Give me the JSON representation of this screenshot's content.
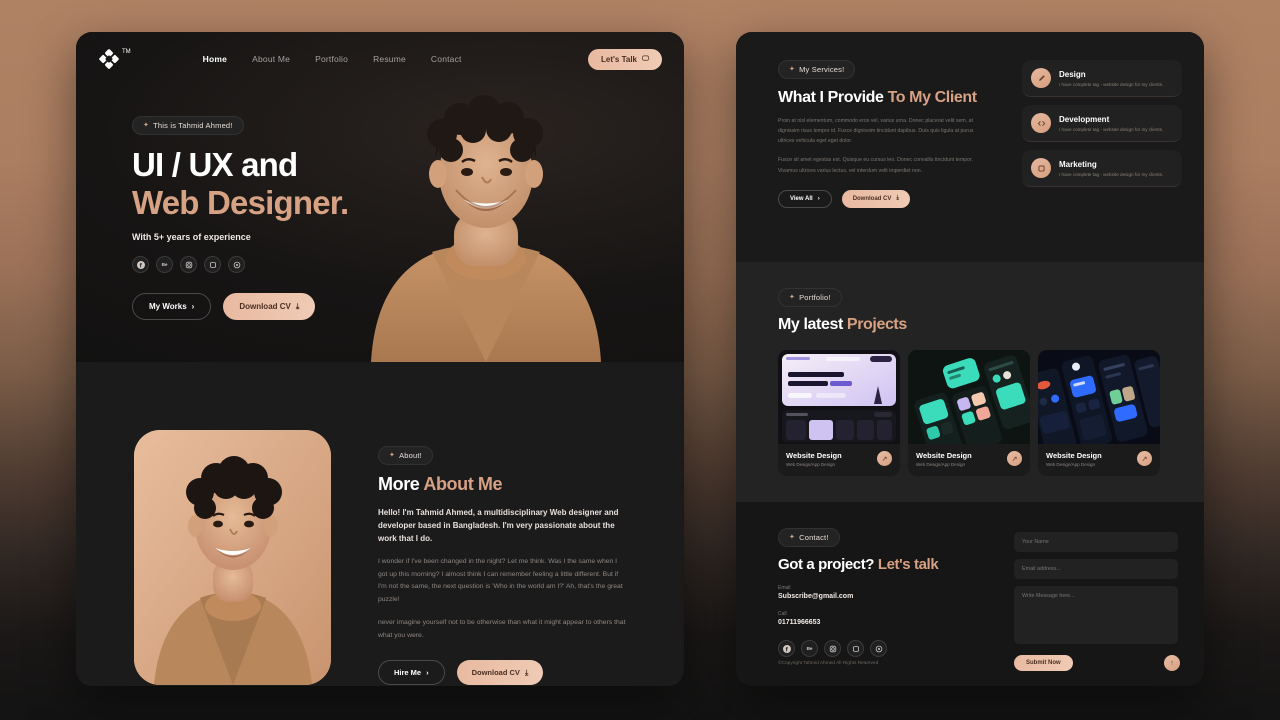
{
  "colors": {
    "accent": "#d7a183",
    "peach_button": "#e8b9a0",
    "panel_bg": "#1a1a1a",
    "page_gradient_top": "#b08264",
    "page_gradient_bottom": "#131313"
  },
  "left_panel": {
    "nav": {
      "logo_tm": "TM",
      "links": [
        {
          "label": "Home",
          "active": true
        },
        {
          "label": "About Me",
          "active": false
        },
        {
          "label": "Portfolio",
          "active": false
        },
        {
          "label": "Resume",
          "active": false
        },
        {
          "label": "Contact",
          "active": false
        }
      ],
      "cta_label": "Let's Talk"
    },
    "hero": {
      "tag": "This is Tahmid Ahmed!",
      "title_line1": "UI / UX and",
      "title_line2": "Web Designer.",
      "subtitle": "With 5+ years of experience",
      "socials": [
        "facebook-icon",
        "behance-icon",
        "instagram-icon",
        "twitter-icon",
        "dribbble-icon"
      ],
      "button_primary": "My Works",
      "button_secondary": "Download CV"
    },
    "about": {
      "tag": "About!",
      "title_plain": "More ",
      "title_accent": "About Me",
      "lead": "Hello! I'm Tahmid Ahmed, a multidisciplinary Web designer and developer based in Bangladesh. I'm very passionate about the work that I do.",
      "paragraph1": "I wonder if I've been changed in the night? Let me think. Was I the same when I got up this morning? I almost think I can remember feeling a little different. But if I'm not the same, the next question is 'Who in the world am I?' Ah, that's the great puzzle!",
      "paragraph2": "never imagine yourself not to be otherwise than what it might appear to others that what you were.",
      "button_primary": "Hire Me",
      "button_secondary": "Download CV"
    }
  },
  "right_panel": {
    "services": {
      "tag": "My Services!",
      "title_plain": "What I Provide ",
      "title_accent": "To My Client",
      "paragraph1": "Proin at nisl elementum, commodo eros vel, varius urna. Donec placerat velit sem, at dignissim risus tempor id. Fusce dignissim tincidunt dapibus. Duis quis ligula at purus ultrices vehicula eget eget dolor.",
      "paragraph2": "Fusce sit amet egestas est. Quisque eu cursus leo. Donec convallis tincidunt tempor. Vivamus ultrices varius lectus, vel interdum velit imperdiet non.",
      "button_primary": "View All",
      "button_secondary": "Download CV",
      "cards": [
        {
          "icon": "design-pen-icon",
          "title": "Design",
          "desc": "I have complete tag - website design for my clients."
        },
        {
          "icon": "code-icon",
          "title": "Development",
          "desc": "I have complete tag - website design for my clients."
        },
        {
          "icon": "megaphone-icon",
          "title": "Marketing",
          "desc": "I have complete tag - website design for my clients."
        }
      ]
    },
    "portfolio": {
      "tag": "Portfolio!",
      "title_plain": "My latest ",
      "title_accent": "Projects",
      "projects": [
        {
          "name": "Website Design",
          "category": "Web Design/App Design",
          "thumb": "purple-landing-page-mockup",
          "arrow": "arrow-up-right-icon"
        },
        {
          "name": "Website Design",
          "category": "Web Design/App Design",
          "thumb": "teal-mobile-app-mockup",
          "arrow": "arrow-up-right-icon"
        },
        {
          "name": "Website Design",
          "category": "Web Design/App Design",
          "thumb": "blue-dark-mobile-mockup",
          "arrow": "arrow-up-right-icon"
        }
      ]
    },
    "contact": {
      "tag": "Contact!",
      "title_plain": "Got a project? ",
      "title_accent": "Let's talk",
      "email_label": "Email",
      "email_value": "Subscribe@gmail.com",
      "phone_label": "Call",
      "phone_value": "01711966653",
      "socials": [
        "facebook-icon",
        "behance-icon",
        "instagram-icon",
        "twitter-icon",
        "dribbble-icon"
      ],
      "form": {
        "name_placeholder": "Your Name",
        "email_placeholder": "Email address...",
        "message_placeholder": "Write Message here...",
        "submit_label": "Submit Now"
      }
    },
    "footer": {
      "copyright": "©Copyright Tahmid Ahmed All Rights Reserved",
      "scroll_top": "arrow-up-icon"
    }
  }
}
